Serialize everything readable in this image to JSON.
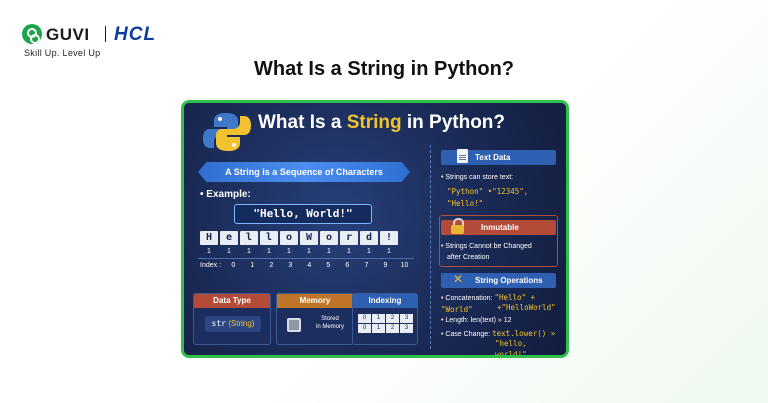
{
  "brand": {
    "guvi": "GUVI",
    "hcl": "HCL",
    "tagline": "Skill Up. Level Up"
  },
  "page_title": "What Is a String in Python?",
  "poster": {
    "title_pre": "What Is a ",
    "title_highlight": "String",
    "title_mid": " in ",
    "title_post": "Python?",
    "ribbon": "A String is a Sequence of Characters",
    "example_label": "• Example:",
    "example_value": "\"Hello, World!\"",
    "chars": [
      "H",
      "e",
      "l",
      "l",
      "o",
      "W",
      "o",
      "r",
      "d",
      "!"
    ],
    "ones": [
      "1",
      "1",
      "1",
      "1",
      "1",
      "1",
      "1",
      "1",
      "1",
      "1"
    ],
    "index_label": "Index :",
    "indices": [
      "0",
      "1",
      "2",
      "3",
      "4",
      "5",
      "6",
      "7",
      "9",
      "10"
    ],
    "cards": {
      "data_type": {
        "header": "Data Type",
        "code": "str",
        "paren": "(String)"
      },
      "memory": {
        "header": "Memory",
        "line1": "Stored",
        "line2": "in Memory"
      },
      "indexing": {
        "header": "Indexing",
        "grid": [
          "0",
          "1",
          "2",
          "3",
          "0",
          "1",
          "2",
          "3"
        ]
      }
    },
    "side": {
      "text_data": {
        "header": "Text Data",
        "line": "• Strings can store text:",
        "code1": "\"Python\"  •\"12345\",",
        "code2": "\"Hello!\""
      },
      "immutable": {
        "header": "Inmutable",
        "line1": "• Strings Cannot be Changed",
        "line2": "after Creation"
      },
      "operations": {
        "header": "String Operations",
        "concat_label": "• Concatenation: ",
        "concat_code": "\"Hello\" + \"World\"",
        "concat_result": "+\"HelloWorld\"",
        "length_label": "• Length: ",
        "length_value": "len(text) » 12",
        "case_label": "• Case Change: ",
        "case_code": "text.lower() »",
        "case_result": "\"hello, world!\""
      }
    }
  },
  "colors": {
    "accent_green": "#2fbf4a",
    "poster_bg": "#1b2a52",
    "highlight_yellow": "#f2c230",
    "ribbon_blue": "#2f6fd1",
    "red_header": "#b34b38",
    "orange_header": "#c07427"
  }
}
